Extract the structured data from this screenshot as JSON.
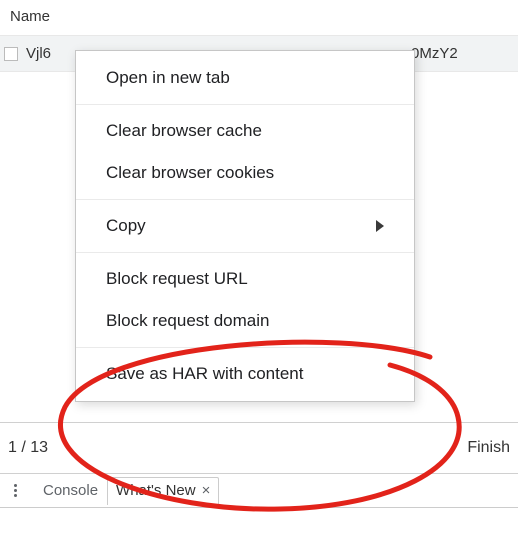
{
  "network_panel": {
    "column_header": "Name",
    "request_row": {
      "left_fragment": "Vjl6",
      "right_fragment": "0MzY2"
    },
    "status_bar": {
      "left": "1 / 13",
      "right": "Finish"
    }
  },
  "context_menu": {
    "groups": [
      [
        "Open in new tab"
      ],
      [
        "Clear browser cache",
        "Clear browser cookies"
      ],
      [
        {
          "label": "Copy",
          "submenu": true
        }
      ],
      [
        "Block request URL",
        "Block request domain"
      ],
      [
        "Save as HAR with content"
      ]
    ]
  },
  "bottom_tabs": {
    "console": "Console",
    "whats_new": {
      "label": "What's New",
      "close": "×"
    }
  },
  "annotation": {
    "color": "#e2231a"
  }
}
